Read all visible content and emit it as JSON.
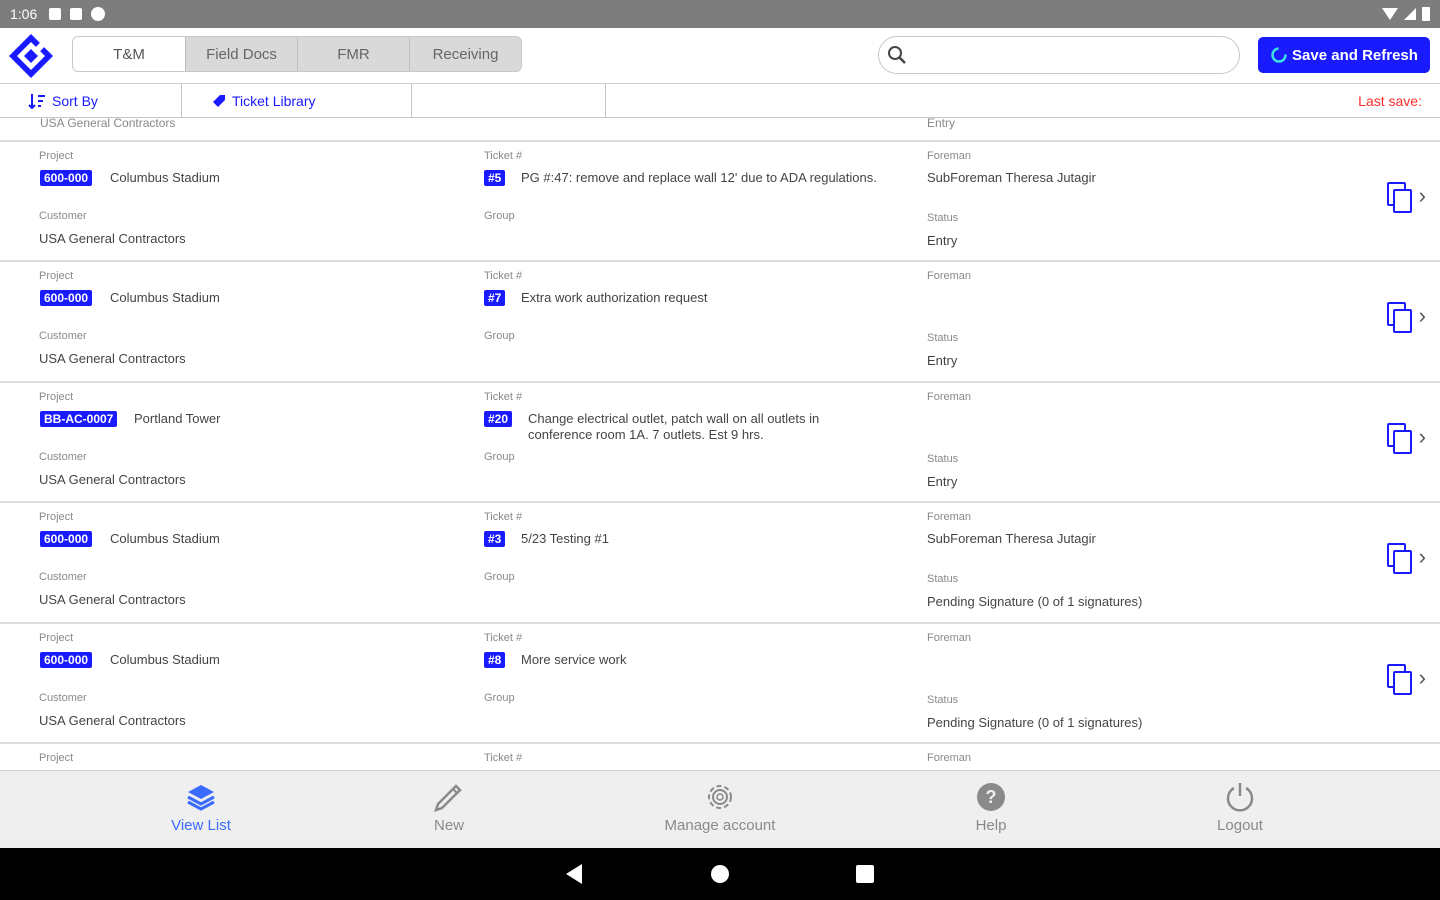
{
  "status_bar": {
    "time": "1:06"
  },
  "header": {
    "tabs": [
      "T&M",
      "Field Docs",
      "FMR",
      "Receiving"
    ],
    "search": {
      "value": "",
      "placeholder": ""
    },
    "save_button": "Save and Refresh"
  },
  "toolbar": {
    "sort_by": "Sort By",
    "ticket_library": "Ticket Library",
    "last_save": "Last save:"
  },
  "labels": {
    "project": "Project",
    "customer": "Customer",
    "ticket": "Ticket #",
    "group": "Group",
    "foreman": "Foreman",
    "status": "Status"
  },
  "partial_top": {
    "customer": "USA General Contractors",
    "status": "Entry"
  },
  "tickets": [
    {
      "project_code": "600-000",
      "project_name": "Columbus Stadium",
      "customer": "USA General Contractors",
      "ticket_no": "#5",
      "description": "PG #:47: remove and replace wall 12' due to ADA regulations.",
      "group": "",
      "foreman": "SubForeman Theresa Jutagir",
      "status": "Entry"
    },
    {
      "project_code": "600-000",
      "project_name": "Columbus Stadium",
      "customer": "USA General Contractors",
      "ticket_no": "#7",
      "description": "Extra work authorization request",
      "group": "",
      "foreman": "",
      "status": "Entry"
    },
    {
      "project_code": "BB-AC-0007",
      "project_name": "Portland Tower",
      "customer": "USA General Contractors",
      "ticket_no": "#20",
      "description": "Change electrical outlet, patch wall on all outlets in conference room 1A. 7 outlets. Est 9 hrs.",
      "group": "",
      "foreman": "",
      "status": "Entry"
    },
    {
      "project_code": "600-000",
      "project_name": "Columbus Stadium",
      "customer": "USA General Contractors",
      "ticket_no": "#3",
      "description": "5/23 Testing #1",
      "group": "",
      "foreman": "SubForeman Theresa Jutagir",
      "status": "Pending Signature (0 of 1 signatures)"
    },
    {
      "project_code": "600-000",
      "project_name": "Columbus Stadium",
      "customer": "USA General Contractors",
      "ticket_no": "#8",
      "description": "More service work",
      "group": "",
      "foreman": "",
      "status": "Pending Signature (0 of 1 signatures)"
    }
  ],
  "bottom_nav": [
    {
      "label": "View List",
      "icon": "layers-icon",
      "active": true
    },
    {
      "label": "New",
      "icon": "pencil-icon",
      "active": false
    },
    {
      "label": "Manage account",
      "icon": "gear-icon",
      "active": false
    },
    {
      "label": "Help",
      "icon": "help-icon",
      "active": false
    },
    {
      "label": "Logout",
      "icon": "power-icon",
      "active": false
    }
  ],
  "colors": {
    "accent": "#1a1aff",
    "nav_active": "#3b6cff",
    "last_save": "#ff2b2b",
    "status_bar": "#7d7d7d"
  }
}
